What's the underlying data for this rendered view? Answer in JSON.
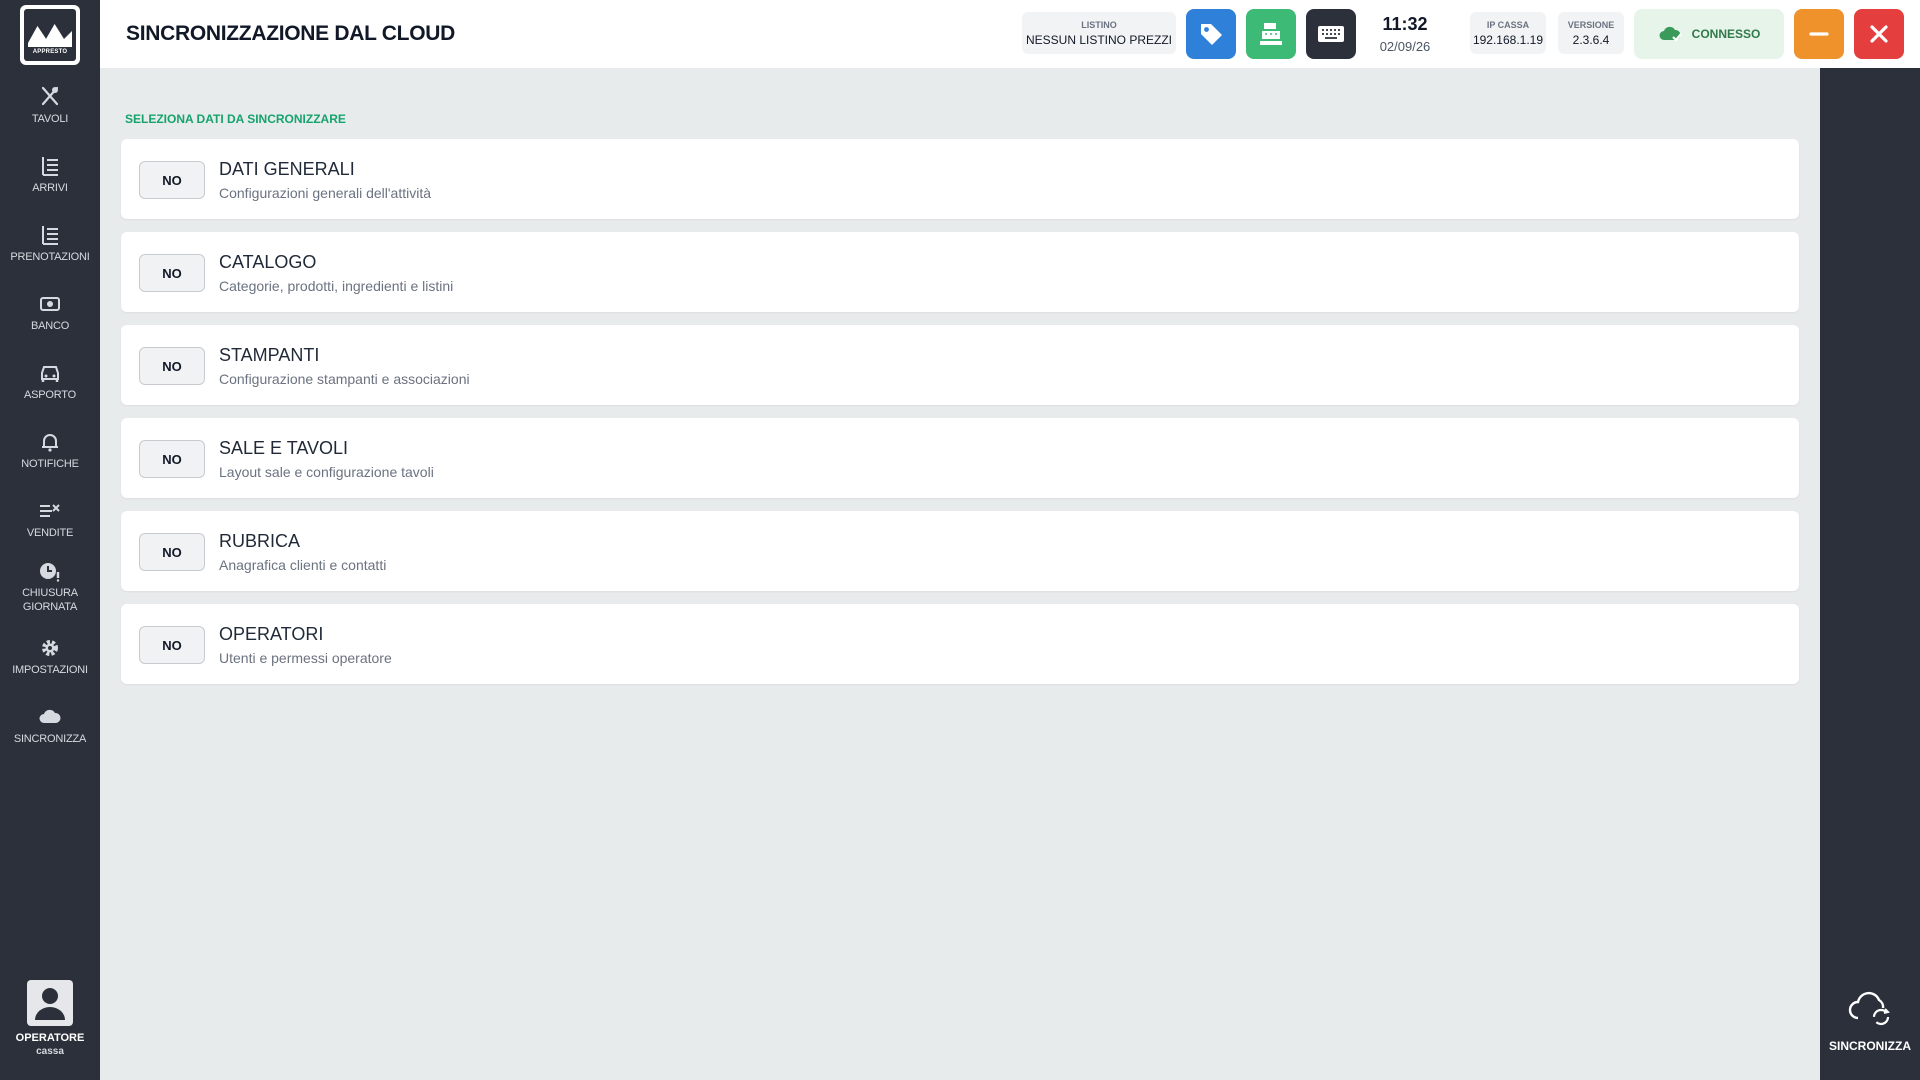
{
  "sidebar": {
    "logo_text": "APPRESTO",
    "items": [
      {
        "label": "TAVOLI"
      },
      {
        "label": "ARRIVI"
      },
      {
        "label": "PRENOTAZIONI"
      },
      {
        "label": "BANCO"
      },
      {
        "label": "ASPORTO"
      },
      {
        "label": "NOTIFICHE"
      },
      {
        "label": "VENDITE"
      },
      {
        "label": "CHIUSURA\nGIORNATA"
      },
      {
        "label": "IMPOSTAZIONI"
      },
      {
        "label": "SINCRONIZZA"
      }
    ],
    "operator": {
      "name": "OPERATORE",
      "role": "cassa"
    }
  },
  "header": {
    "title": "SINCRONIZZAZIONE DAL CLOUD",
    "listino": {
      "caption": "LISTINO",
      "value": "NESSUN LISTINO PREZZI"
    },
    "time": "11:32",
    "date": "02/09/26",
    "ip": {
      "caption": "IP CASSA",
      "value": "192.168.1.19"
    },
    "version": {
      "caption": "VERSIONE",
      "value": "2.3.6.4"
    },
    "status": "CONNESSO",
    "colors": {
      "tag_button": "#2f80d8",
      "register_button": "#3dbb76",
      "keyboard_button": "#2b303a",
      "minimize_button": "#f0922b",
      "close_button": "#e53e3e"
    }
  },
  "main": {
    "section_label": "SELEZIONA DATI DA SINCRONIZZARE",
    "rows": [
      {
        "toggle": "NO",
        "title": "DATI GENERALI",
        "desc": "Configurazioni generali dell'attività"
      },
      {
        "toggle": "NO",
        "title": "CATALOGO",
        "desc": "Categorie, prodotti, ingredienti e listini"
      },
      {
        "toggle": "NO",
        "title": "STAMPANTI",
        "desc": "Configurazione stampanti e associazioni"
      },
      {
        "toggle": "NO",
        "title": "SALE E TAVOLI",
        "desc": "Layout sale e configurazione tavoli"
      },
      {
        "toggle": "NO",
        "title": "RUBRICA",
        "desc": "Anagrafica clienti e contatti"
      },
      {
        "toggle": "NO",
        "title": "OPERATORI",
        "desc": "Utenti e permessi operatore"
      }
    ]
  },
  "right_panel": {
    "sync_label": "SINCRONIZZA"
  }
}
